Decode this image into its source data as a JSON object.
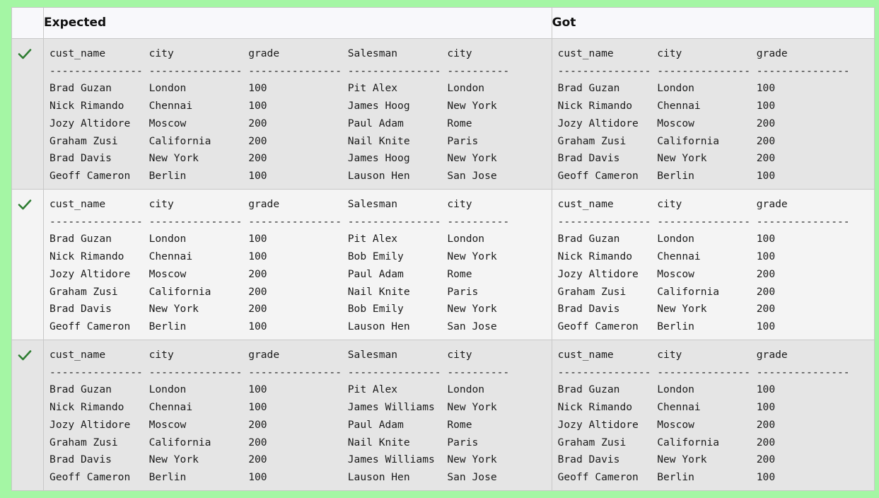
{
  "headers": {
    "expected": "Expected",
    "got": "Got"
  },
  "rows": [
    {
      "status": "pass",
      "expected": "cust_name       city            grade           Salesman        city\n--------------- --------------- --------------- --------------- ----------\nBrad Guzan      London          100             Pit Alex        London\nNick Rimando    Chennai         100             James Hoog      New York\nJozy Altidore   Moscow          200             Paul Adam       Rome\nGraham Zusi     California      200             Nail Knite      Paris\nBrad Davis      New York        200             James Hoog      New York\nGeoff Cameron   Berlin          100             Lauson Hen      San Jose",
      "got": "cust_name       city            grade\n--------------- --------------- ---------------\nBrad Guzan      London          100\nNick Rimando    Chennai         100\nJozy Altidore   Moscow          200\nGraham Zusi     California      200\nBrad Davis      New York        200\nGeoff Cameron   Berlin          100"
    },
    {
      "status": "pass",
      "expected": "cust_name       city            grade           Salesman        city\n--------------- --------------- --------------- --------------- ----------\nBrad Guzan      London          100             Pit Alex        London\nNick Rimando    Chennai         100             Bob Emily       New York\nJozy Altidore   Moscow          200             Paul Adam       Rome\nGraham Zusi     California      200             Nail Knite      Paris\nBrad Davis      New York        200             Bob Emily       New York\nGeoff Cameron   Berlin          100             Lauson Hen      San Jose",
      "got": "cust_name       city            grade\n--------------- --------------- ---------------\nBrad Guzan      London          100\nNick Rimando    Chennai         100\nJozy Altidore   Moscow          200\nGraham Zusi     California      200\nBrad Davis      New York        200\nGeoff Cameron   Berlin          100"
    },
    {
      "status": "pass",
      "expected": "cust_name       city            grade           Salesman        city\n--------------- --------------- --------------- --------------- ----------\nBrad Guzan      London          100             Pit Alex        London\nNick Rimando    Chennai         100             James Williams  New York\nJozy Altidore   Moscow          200             Paul Adam       Rome\nGraham Zusi     California      200             Nail Knite      Paris\nBrad Davis      New York        200             James Williams  New York\nGeoff Cameron   Berlin          100             Lauson Hen      San Jose",
      "got": "cust_name       city            grade\n--------------- --------------- ---------------\nBrad Guzan      London          100\nNick Rimando    Chennai         100\nJozy Altidore   Moscow          200\nGraham Zusi     California      200\nBrad Davis      New York        200\nGeoff Cameron   Berlin          100"
    }
  ],
  "icons": {
    "status_icon": "check-icon"
  },
  "colors": {
    "check": "#2e7d32",
    "background": "#a4f6a4"
  }
}
